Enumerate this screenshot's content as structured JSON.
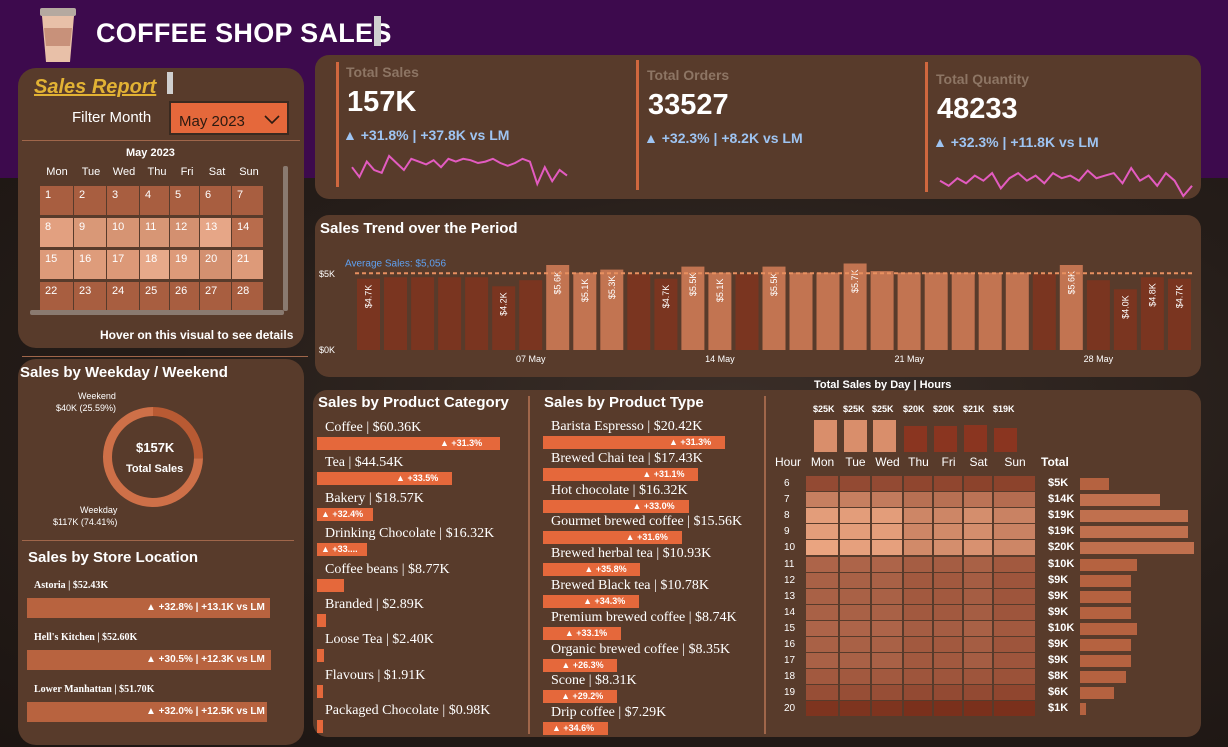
{
  "header": {
    "title": "COFFEE SHOP SALES"
  },
  "report": {
    "title": "Sales Report",
    "filter_label": "Filter Month",
    "filter_value": "May 2023",
    "calendar": {
      "month_title": "May 2023",
      "weekdays": [
        "Mon",
        "Tue",
        "Wed",
        "Thu",
        "Fri",
        "Sat",
        "Sun"
      ],
      "days": [
        "1",
        "2",
        "3",
        "4",
        "5",
        "6",
        "7",
        "8",
        "9",
        "10",
        "11",
        "12",
        "13",
        "14",
        "15",
        "16",
        "17",
        "18",
        "19",
        "20",
        "21",
        "22",
        "23",
        "24",
        "25",
        "26",
        "27",
        "28"
      ],
      "day_colors": [
        "#a85e40",
        "#a85e40",
        "#a85e40",
        "#a85e40",
        "#a85e40",
        "#a85e40",
        "#a85e40",
        "#e2a080",
        "#d99877",
        "#d69473",
        "#d79675",
        "#d39070",
        "#e6a687",
        "#b86c4c",
        "#dd9a79",
        "#de9c7b",
        "#dc9978",
        "#e7a98a",
        "#dd9a79",
        "#d39070",
        "#dd9a79",
        "#a85e40",
        "#a85e40",
        "#a85e40",
        "#a85e40",
        "#a85e40",
        "#a85e40",
        "#a85e40"
      ],
      "hint": "Hover on this visual to see details"
    }
  },
  "kpis": [
    {
      "title": "Total Sales",
      "value": "157K",
      "delta": "▲ +31.8% | +37.8K vs LM",
      "spark": [
        52,
        45,
        56,
        50,
        48,
        60,
        55,
        50,
        58,
        56,
        54,
        57,
        52,
        58,
        56,
        58,
        57,
        55,
        56,
        58,
        55,
        53,
        55,
        58,
        56,
        40,
        52,
        42,
        50,
        46
      ]
    },
    {
      "title": "Total Orders",
      "value": "33527",
      "delta": "▲ +32.3% | +8.2K vs LM",
      "spark": [
        45,
        40,
        46,
        42,
        48,
        50,
        44,
        52,
        50,
        46,
        48,
        55,
        42,
        52,
        48,
        50,
        45,
        55,
        48,
        50,
        52,
        45,
        58,
        44,
        50,
        42,
        55,
        48,
        36,
        42
      ]
    },
    {
      "title": "Total Quantity",
      "value": "48233",
      "delta": "▲ +32.3% | +11.8K vs LM",
      "spark": [
        46,
        42,
        48,
        44,
        50,
        46,
        52,
        40,
        48,
        52,
        46,
        50,
        44,
        52,
        48,
        50,
        46,
        54,
        48,
        50,
        52,
        44,
        56,
        46,
        50,
        42,
        52,
        46,
        34,
        42
      ]
    }
  ],
  "trend": {
    "title": "Sales Trend over the Period",
    "avg_label": "Average Sales: $5,056",
    "y_ticks": [
      "$5K",
      "$0K"
    ],
    "x_labels": [
      "07 May",
      "14 May",
      "21 May",
      "28 May"
    ],
    "chart_data": {
      "type": "bar",
      "title": "Sales Trend over the Period",
      "x": [
        "1",
        "2",
        "3",
        "4",
        "5",
        "6",
        "7",
        "8",
        "9",
        "10",
        "11",
        "12",
        "13",
        "14",
        "15",
        "16",
        "17",
        "18",
        "19",
        "20",
        "21",
        "22",
        "23",
        "24",
        "25",
        "26",
        "27",
        "28",
        "29",
        "30",
        "31"
      ],
      "values": [
        4.7,
        4.8,
        4.8,
        4.8,
        4.8,
        4.2,
        4.6,
        5.6,
        5.1,
        5.3,
        5.0,
        4.7,
        5.5,
        5.1,
        5.0,
        5.5,
        5.1,
        5.1,
        5.7,
        5.2,
        5.1,
        5.1,
        5.1,
        5.1,
        5.1,
        5.0,
        5.6,
        4.6,
        4.0,
        4.8,
        4.7
      ],
      "labels": [
        "$4.7K",
        "",
        "",
        "",
        "",
        "$4.2K",
        "",
        "$5.6K",
        "$5.1K",
        "$5.3K",
        "",
        "$4.7K",
        "$5.5K",
        "$5.1K",
        "",
        "$5.5K",
        "",
        "",
        "$5.7K",
        "",
        "",
        "",
        "",
        "",
        "",
        "",
        "$5.6K",
        "",
        "$4.0K",
        "$4.8K",
        "$4.7K"
      ],
      "average": 5.056,
      "ylim": [
        0,
        5.8
      ],
      "colors": {
        "above": "#c27451",
        "below": "#7a3520"
      }
    }
  },
  "weekday": {
    "title": "Sales by Weekday / Weekend",
    "center_value": "$157K",
    "center_label": "Total Sales",
    "weekend_label": "Weekend",
    "weekend_value": "$40K (25.59%)",
    "weekday_label": "Weekday",
    "weekday_value": "$117K (74.41%)",
    "chart_data": {
      "type": "pie",
      "categories": [
        "Weekend",
        "Weekday"
      ],
      "values": [
        40,
        117
      ],
      "colors": [
        "#b85a33",
        "#ce7048"
      ]
    }
  },
  "locations": {
    "title": "Sales by Store Location",
    "items": [
      {
        "name": "Astoria | $52.43K",
        "delta": "▲ +32.8% | +13.1K vs LM",
        "value": 52.43
      },
      {
        "name": "Hell's Kitchen | $52.60K",
        "delta": "▲ +30.5% | +12.3K vs LM",
        "value": 52.6
      },
      {
        "name": "Lower Manhattan | $51.70K",
        "delta": "▲ +32.0% | +12.5K vs LM",
        "value": 51.7
      }
    ]
  },
  "category": {
    "title": "Sales by Product Category",
    "items": [
      {
        "label": "Coffee | $60.36K",
        "delta": "▲ +31.3%",
        "value": 60.36
      },
      {
        "label": "Tea | $44.54K",
        "delta": "▲ +33.5%",
        "value": 44.54
      },
      {
        "label": "Bakery | $18.57K",
        "delta": "▲ +32.4%",
        "value": 18.57
      },
      {
        "label": "Drinking Chocolate | $16.32K",
        "delta": "▲ +33....",
        "value": 16.32
      },
      {
        "label": "Coffee beans | $8.77K",
        "delta": "",
        "value": 8.77
      },
      {
        "label": "Branded | $2.89K",
        "delta": "",
        "value": 2.89
      },
      {
        "label": "Loose Tea | $2.40K",
        "delta": "",
        "value": 2.4
      },
      {
        "label": "Flavours | $1.91K",
        "delta": "",
        "value": 1.91
      },
      {
        "label": "Packaged Chocolate | $0.98K",
        "delta": "",
        "value": 0.98
      }
    ]
  },
  "ptype": {
    "title": "Sales by Product Type",
    "items": [
      {
        "label": "Barista Espresso | $20.42K",
        "delta": "▲ +31.3%",
        "value": 20.42
      },
      {
        "label": "Brewed Chai tea | $17.43K",
        "delta": "▲ +31.1%",
        "value": 17.43
      },
      {
        "label": "Hot chocolate | $16.32K",
        "delta": "▲ +33.0%",
        "value": 16.32
      },
      {
        "label": "Gourmet brewed coffee | $15.56K",
        "delta": "▲ +31.6%",
        "value": 15.56
      },
      {
        "label": "Brewed herbal tea | $10.93K",
        "delta": "▲ +35.8%",
        "value": 10.93
      },
      {
        "label": "Brewed Black tea | $10.78K",
        "delta": "▲ +34.3%",
        "value": 10.78
      },
      {
        "label": "Premium brewed coffee | $8.74K",
        "delta": "▲ +33.1%",
        "value": 8.74
      },
      {
        "label": "Organic brewed coffee | $8.35K",
        "delta": "▲ +26.3%",
        "value": 8.35
      },
      {
        "label": "Scone | $8.31K",
        "delta": "▲ +29.2%",
        "value": 8.31
      },
      {
        "label": "Drip coffee | $7.29K",
        "delta": "▲ +34.6%",
        "value": 7.29
      }
    ]
  },
  "heatmap": {
    "title": "Total Sales by Day | Hours",
    "hour_label": "Hour",
    "total_label": "Total",
    "days": [
      "Mon",
      "Tue",
      "Wed",
      "Thu",
      "Fri",
      "Sat",
      "Sun"
    ],
    "day_totals": [
      "$25K",
      "$25K",
      "$25K",
      "$20K",
      "$20K",
      "$21K",
      "$19K"
    ],
    "day_values": [
      25,
      25,
      25,
      20,
      20,
      21,
      19
    ],
    "hours": [
      "6",
      "7",
      "8",
      "9",
      "10",
      "11",
      "12",
      "13",
      "14",
      "15",
      "16",
      "17",
      "18",
      "19",
      "20"
    ],
    "hour_totals": [
      "$5K",
      "$14K",
      "$19K",
      "$19K",
      "$20K",
      "$10K",
      "$9K",
      "$9K",
      "$9K",
      "$10K",
      "$9K",
      "$9K",
      "$8K",
      "$6K",
      "$1K"
    ],
    "hour_values": [
      5,
      14,
      19,
      19,
      20,
      10,
      9,
      9,
      9,
      10,
      9,
      9,
      8,
      6,
      1
    ],
    "chart_data": {
      "type": "heatmap",
      "x": [
        "Mon",
        "Tue",
        "Wed",
        "Thu",
        "Fri",
        "Sat",
        "Sun"
      ],
      "y": [
        "6",
        "7",
        "8",
        "9",
        "10",
        "11",
        "12",
        "13",
        "14",
        "15",
        "16",
        "17",
        "18",
        "19",
        "20"
      ],
      "values": [
        [
          0.8,
          0.8,
          0.8,
          0.7,
          0.7,
          0.6,
          0.6
        ],
        [
          2.2,
          2.2,
          2.1,
          1.8,
          1.8,
          1.9,
          1.7
        ],
        [
          3.0,
          3.0,
          3.0,
          2.4,
          2.4,
          2.6,
          2.3
        ],
        [
          3.0,
          3.0,
          3.0,
          2.4,
          2.5,
          2.6,
          2.3
        ],
        [
          3.2,
          3.1,
          3.1,
          2.5,
          2.6,
          2.7,
          2.4
        ],
        [
          1.5,
          1.5,
          1.5,
          1.3,
          1.3,
          1.4,
          1.2
        ],
        [
          1.4,
          1.4,
          1.4,
          1.2,
          1.2,
          1.3,
          1.1
        ],
        [
          1.4,
          1.4,
          1.4,
          1.2,
          1.2,
          1.3,
          1.1
        ],
        [
          1.4,
          1.4,
          1.4,
          1.2,
          1.2,
          1.3,
          1.1
        ],
        [
          1.5,
          1.5,
          1.5,
          1.3,
          1.3,
          1.4,
          1.2
        ],
        [
          1.4,
          1.4,
          1.4,
          1.2,
          1.2,
          1.3,
          1.1
        ],
        [
          1.4,
          1.4,
          1.4,
          1.2,
          1.2,
          1.3,
          1.1
        ],
        [
          1.2,
          1.2,
          1.2,
          1.1,
          1.1,
          1.1,
          1.0
        ],
        [
          0.9,
          0.9,
          0.9,
          0.8,
          0.8,
          0.8,
          0.7
        ],
        [
          0.2,
          0.2,
          0.2,
          0.1,
          0.1,
          0.1,
          0.1
        ]
      ]
    }
  }
}
